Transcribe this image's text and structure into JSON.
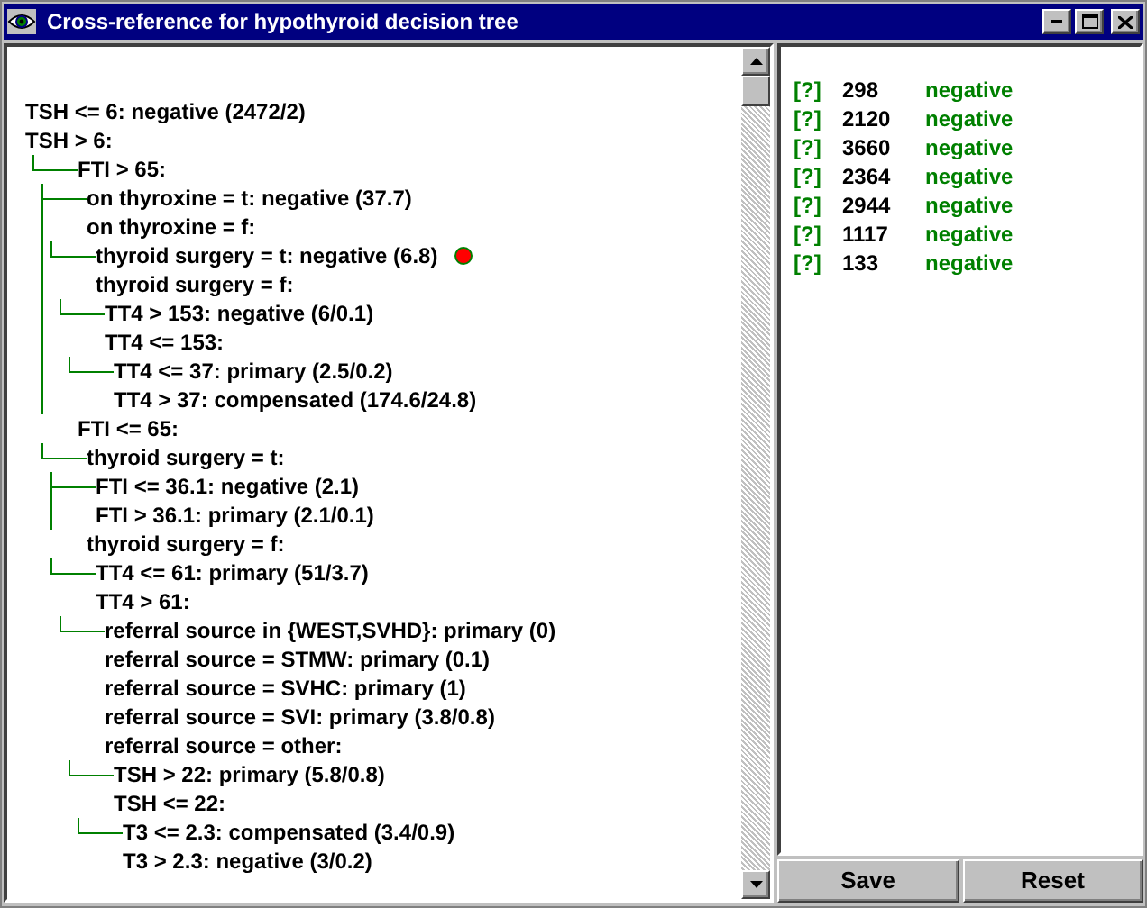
{
  "window": {
    "title": "Cross-reference for hypothyroid decision tree"
  },
  "tree": [
    {
      "text": "TSH <= 6: negative (2472/2)",
      "marked": false
    },
    {
      "text": "TSH > 6:",
      "marked": false,
      "full_guide": false,
      "children": [
        {
          "text": "FTI > 65:",
          "marked": false,
          "full_guide": true,
          "children": [
            {
              "text": "on thyroxine = t: negative (37.7)",
              "marked": false
            },
            {
              "text": "on thyroxine = f:",
              "marked": false,
              "full_guide": false,
              "children": [
                {
                  "text": "thyroid surgery = t: negative (6.8)",
                  "marked": true
                },
                {
                  "text": "thyroid surgery = f:",
                  "marked": false,
                  "full_guide": false,
                  "children": [
                    {
                      "text": "TT4 > 153: negative (6/0.1)",
                      "marked": false
                    },
                    {
                      "text": "TT4 <= 153:",
                      "marked": false,
                      "full_guide": false,
                      "children": [
                        {
                          "text": "TT4 <= 37: primary (2.5/0.2)",
                          "marked": false
                        },
                        {
                          "text": "TT4 > 37: compensated (174.6/24.8)",
                          "marked": false
                        }
                      ]
                    }
                  ]
                }
              ]
            }
          ]
        },
        {
          "text": "FTI <= 65:",
          "marked": false,
          "full_guide": false,
          "children": [
            {
              "text": "thyroid surgery = t:",
              "marked": false,
              "full_guide": true,
              "children": [
                {
                  "text": "FTI <= 36.1: negative (2.1)",
                  "marked": false
                },
                {
                  "text": "FTI > 36.1: primary (2.1/0.1)",
                  "marked": false
                }
              ]
            },
            {
              "text": "thyroid surgery = f:",
              "marked": false,
              "full_guide": false,
              "children": [
                {
                  "text": "TT4 <= 61: primary (51/3.7)",
                  "marked": false
                },
                {
                  "text": "TT4 > 61:",
                  "marked": false,
                  "full_guide": false,
                  "children": [
                    {
                      "text": "referral source in {WEST,SVHD}: primary (0)",
                      "marked": false
                    },
                    {
                      "text": "referral source = STMW: primary (0.1)",
                      "marked": false
                    },
                    {
                      "text": "referral source = SVHC: primary (1)",
                      "marked": false
                    },
                    {
                      "text": "referral source = SVI: primary (3.8/0.8)",
                      "marked": false
                    },
                    {
                      "text": "referral source = other:",
                      "marked": false,
                      "full_guide": false,
                      "children": [
                        {
                          "text": "TSH > 22: primary (5.8/0.8)",
                          "marked": false
                        },
                        {
                          "text": "TSH <= 22:",
                          "marked": false,
                          "full_guide": false,
                          "children": [
                            {
                              "text": "T3 <= 2.3: compensated (3.4/0.9)",
                              "marked": false
                            },
                            {
                              "text": "T3 > 2.3: negative (3/0.2)",
                              "marked": false
                            }
                          ]
                        }
                      ]
                    }
                  ]
                }
              ]
            }
          ]
        }
      ]
    }
  ],
  "cases": [
    {
      "flag": "[?]",
      "id": "298",
      "class": "negative"
    },
    {
      "flag": "[?]",
      "id": "2120",
      "class": "negative"
    },
    {
      "flag": "[?]",
      "id": "3660",
      "class": "negative"
    },
    {
      "flag": "[?]",
      "id": "2364",
      "class": "negative"
    },
    {
      "flag": "[?]",
      "id": "2944",
      "class": "negative"
    },
    {
      "flag": "[?]",
      "id": "1117",
      "class": "negative"
    },
    {
      "flag": "[?]",
      "id": "133",
      "class": "negative"
    }
  ],
  "buttons": [
    "Save",
    "Reset"
  ]
}
